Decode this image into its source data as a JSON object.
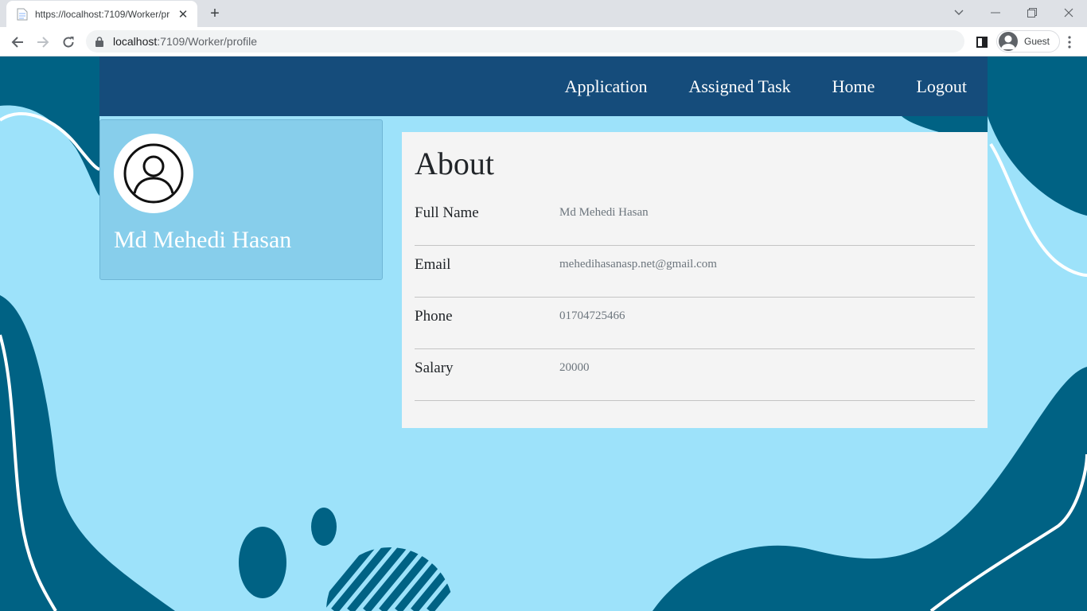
{
  "browser": {
    "tab": {
      "title": "https://localhost:7109/Worker/pr"
    },
    "url_host": "localhost",
    "url_path": ":7109/Worker/profile",
    "profile_label": "Guest"
  },
  "navbar": {
    "links": [
      "Application",
      "Assigned Task",
      "Home",
      "Logout"
    ]
  },
  "profile_card": {
    "name": "Md Mehedi Hasan"
  },
  "about": {
    "title": "About",
    "rows": [
      {
        "label": "Full Name",
        "value": "Md Mehedi Hasan"
      },
      {
        "label": "Email",
        "value": "mehedihasanasp.net@gmail.com"
      },
      {
        "label": "Phone",
        "value": "01704725466"
      },
      {
        "label": "Salary",
        "value": "20000"
      }
    ]
  },
  "colors": {
    "navbar": "#154c7b",
    "page_bg": "#9de2fa",
    "wave": "#006284",
    "card": "#87ceeb",
    "panel": "#f4f4f4"
  }
}
